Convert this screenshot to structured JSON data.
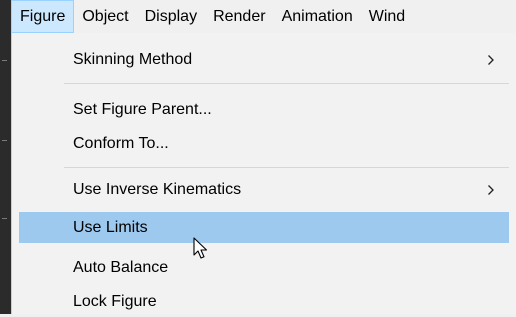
{
  "menubar": {
    "items": [
      {
        "label": "Figure"
      },
      {
        "label": "Object"
      },
      {
        "label": "Display"
      },
      {
        "label": "Render"
      },
      {
        "label": "Animation"
      },
      {
        "label": "Wind"
      }
    ]
  },
  "menu": {
    "items": [
      {
        "label": "Skinning Method",
        "submenu_icon": "chevron-right-icon"
      },
      {
        "label": "Set Figure Parent..."
      },
      {
        "label": "Conform To..."
      },
      {
        "label": "Use Inverse Kinematics",
        "submenu_icon": "chevron-right-icon"
      },
      {
        "label": "Use Limits",
        "state": "highlighted"
      },
      {
        "label": "Auto Balance"
      },
      {
        "label": "Lock Figure"
      }
    ]
  },
  "colors": {
    "menubar_bg": "#f0f0f0",
    "open_menu_bg": "#cce8ff",
    "open_menu_border": "#99d1ff",
    "dropdown_bg": "#f2f2f2",
    "highlight": "#9dc9ef",
    "separator": "#d7d7d7",
    "app_bg": "#2b2b2b"
  },
  "cursor": {
    "icon": "mouse-pointer-icon"
  }
}
